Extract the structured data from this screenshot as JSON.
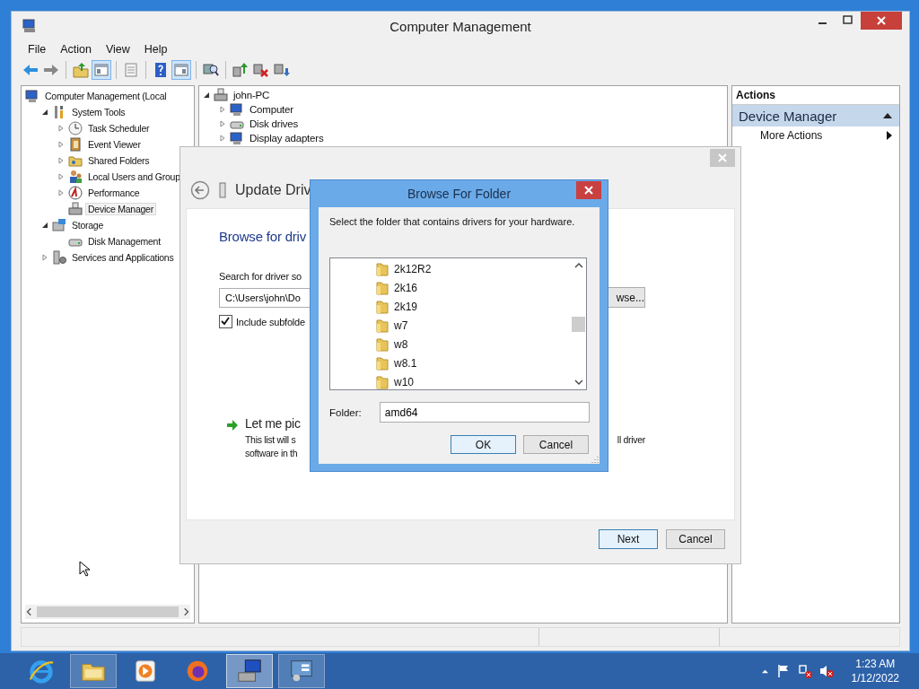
{
  "window": {
    "title": "Computer Management"
  },
  "menu": [
    {
      "label": "File"
    },
    {
      "label": "Action"
    },
    {
      "label": "View"
    },
    {
      "label": "Help"
    }
  ],
  "toolbar": [
    {
      "items": [
        {
          "kind": "back",
          "on": false
        },
        {
          "kind": "forward",
          "on": false
        }
      ]
    },
    {
      "items": [
        {
          "kind": "up",
          "on": false
        },
        {
          "kind": "tree",
          "on": true
        }
      ]
    },
    {
      "items": [
        {
          "kind": "properties",
          "on": false
        }
      ]
    },
    {
      "items": [
        {
          "kind": "help",
          "on": false
        },
        {
          "kind": "actionpane",
          "on": true
        }
      ]
    },
    {
      "items": [
        {
          "kind": "scan",
          "on": false
        }
      ]
    },
    {
      "items": [
        {
          "kind": "update",
          "on": false
        },
        {
          "kind": "disable",
          "on": false
        },
        {
          "kind": "uninstall",
          "on": false
        }
      ]
    }
  ],
  "tree": [
    {
      "label": "Computer Management (Local",
      "kind": "computer",
      "selected": false,
      "children": [
        {
          "label": "System Tools",
          "kind": "tools",
          "expanded": true,
          "selected": false,
          "children": [
            {
              "label": "Task Scheduler",
              "kind": "clock",
              "expanded": false,
              "selected": false
            },
            {
              "label": "Event Viewer",
              "kind": "log",
              "expanded": false,
              "selected": false
            },
            {
              "label": "Shared Folders",
              "kind": "share",
              "expanded": false,
              "selected": false
            },
            {
              "label": "Local Users and Group",
              "kind": "users",
              "expanded": false,
              "selected": false
            },
            {
              "label": "Performance",
              "kind": "gauge",
              "expanded": false,
              "selected": false
            },
            {
              "label": "Device Manager",
              "kind": "device",
              "selected": true
            }
          ]
        },
        {
          "label": "Storage",
          "kind": "storage",
          "expanded": true,
          "selected": false,
          "children": [
            {
              "label": "Disk Management",
              "kind": "disk",
              "selected": false
            }
          ]
        },
        {
          "label": "Services and Applications",
          "kind": "services",
          "expanded": false,
          "selected": false
        }
      ]
    }
  ],
  "device_tree": [
    {
      "label": "john-PC",
      "kind": "device",
      "expanded": true,
      "children": [
        {
          "label": "Computer",
          "kind": "computer",
          "expanded": false
        },
        {
          "label": "Disk drives",
          "kind": "disk",
          "expanded": false
        },
        {
          "label": "Display adapters",
          "kind": "computer",
          "expanded": false
        }
      ]
    }
  ],
  "actions": {
    "header": "Actions",
    "section": {
      "title": "Device Manager",
      "expanded": true
    },
    "items": [
      {
        "label": "More Actions"
      }
    ]
  },
  "update_dialog": {
    "title": "Update Driv",
    "heading": "Browse for driv",
    "search_label": "Search for driver so",
    "path": "C:\\Users\\john\\Do",
    "browse_button": "wse...",
    "include_subfolders": {
      "label": "Include subfolde",
      "checked": true
    },
    "option": {
      "title": "Let me pic",
      "lines": [
        [
          "This list will s",
          "ll driver"
        ],
        [
          "software in th"
        ]
      ]
    },
    "buttons": [
      {
        "label": "Next",
        "default": true
      },
      {
        "label": "Cancel",
        "default": false
      }
    ]
  },
  "browse_dialog": {
    "title": "Browse For Folder",
    "instruction": "Select the folder that contains drivers for your hardware.",
    "folders": [
      {
        "label": "2k12R2"
      },
      {
        "label": "2k16"
      },
      {
        "label": "2k19"
      },
      {
        "label": "w7"
      },
      {
        "label": "w8"
      },
      {
        "label": "w8.1"
      },
      {
        "label": "w10"
      }
    ],
    "folder_label": "Folder:",
    "folder_value": "amd64",
    "buttons": [
      {
        "label": "OK",
        "default": true
      },
      {
        "label": "Cancel",
        "default": false
      }
    ]
  },
  "taskbar": {
    "apps": [
      {
        "kind": "ie",
        "running": false,
        "active": false
      },
      {
        "kind": "explorer",
        "running": true,
        "active": false
      },
      {
        "kind": "media",
        "running": false,
        "active": false
      },
      {
        "kind": "firefox",
        "running": false,
        "active": false
      },
      {
        "kind": "computer",
        "running": true,
        "active": true
      },
      {
        "kind": "control",
        "running": true,
        "active": false
      }
    ],
    "time": "1:23 AM",
    "date": "1/12/2022"
  }
}
